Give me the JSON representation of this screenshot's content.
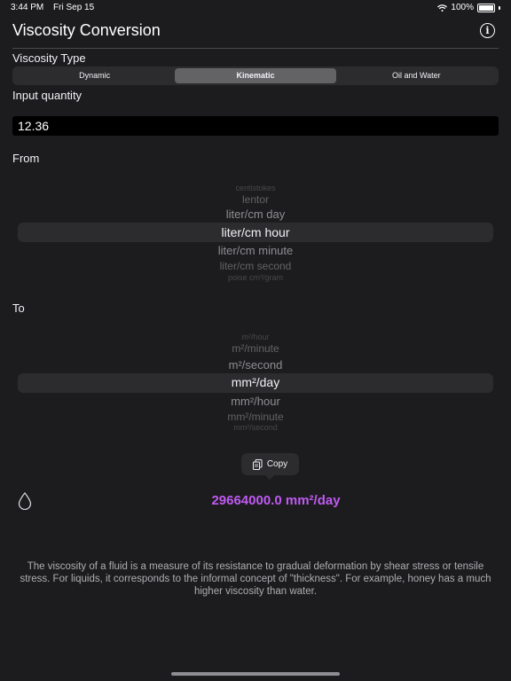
{
  "status_bar": {
    "time": "3:44 PM",
    "date": "Fri Sep 15",
    "battery": "100%"
  },
  "header": {
    "title": "Viscosity Conversion",
    "info_icon": "info-circle-icon"
  },
  "viscosity_type": {
    "label": "Viscosity Type",
    "options": [
      "Dynamic",
      "Kinematic",
      "Oil and Water"
    ],
    "selected": "Kinematic"
  },
  "input": {
    "label": "Input quantity",
    "value": "12.36"
  },
  "from": {
    "label": "From",
    "items": [
      "centistokes",
      "lentor",
      "liter/cm day",
      "liter/cm hour",
      "liter/cm minute",
      "liter/cm second",
      "poise cm³/gram"
    ],
    "selected": "liter/cm hour"
  },
  "to": {
    "label": "To",
    "items": [
      "m²/hour",
      "m²/minute",
      "m²/second",
      "mm²/day",
      "mm²/hour",
      "mm²/minute",
      "mm²/second"
    ],
    "selected": "mm²/day"
  },
  "copy": {
    "label": "Copy",
    "icon": "copy-icon"
  },
  "result": {
    "icon": "drop-icon",
    "value": "29664000.0 mm²/day"
  },
  "description": "The viscosity of a fluid is a measure of its resistance to gradual deformation by shear stress or tensile stress. For liquids, it corresponds to the informal concept of \"thickness\". For example, honey has a much higher viscosity than water.",
  "colors": {
    "accent": "#bf5af2",
    "background": "#1c1c1e"
  }
}
